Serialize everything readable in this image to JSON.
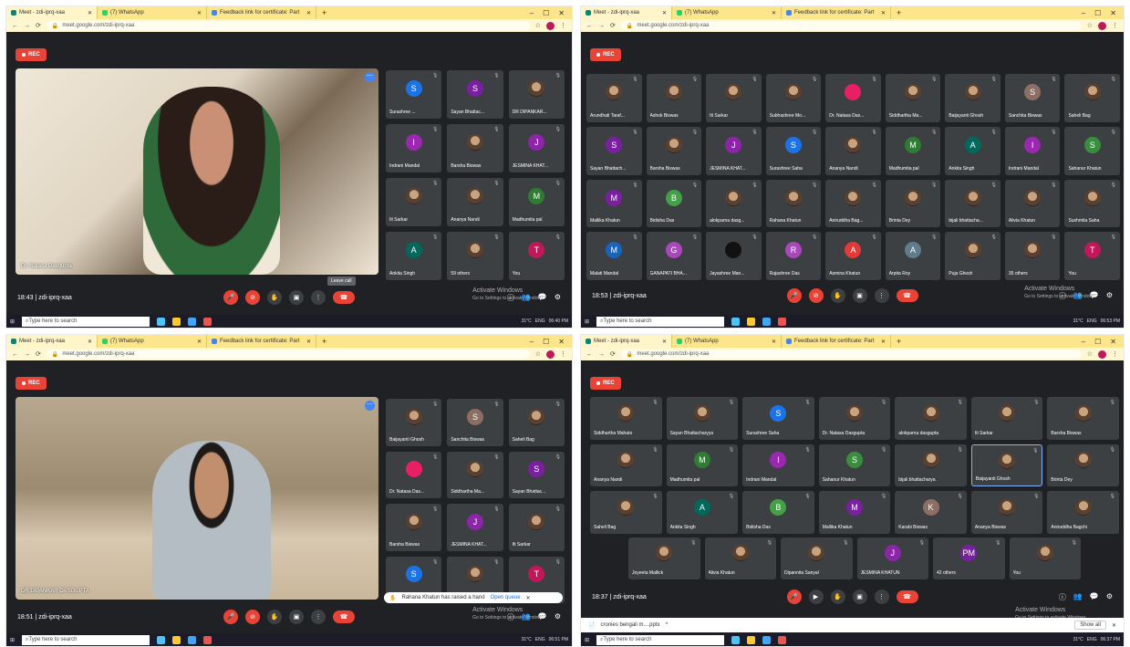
{
  "browser": {
    "tabs": [
      "Meet - zdi-iprq-xaa",
      "(7) WhatsApp",
      "Feedback link for certificate: Part"
    ],
    "new_tab": "+",
    "url": "meet.google.com/zdi-iprq-xaa",
    "controls": [
      "–",
      "☐",
      "✕"
    ]
  },
  "rec_label": "REC",
  "taskbar": {
    "search_placeholder": "Type here to search",
    "weather": "31°C",
    "lang": "ENG"
  },
  "activate": {
    "title": "Activate Windows",
    "sub": "Go to Settings to activate Windows."
  },
  "screens": [
    {
      "time": "18:43",
      "meeting_code": "zdi-iprq-xaa",
      "taskbar_time": "06:40 PM",
      "speaker": "Dr. Natasa Dasgupta",
      "leave_tooltip": "Leave call",
      "tiles": [
        {
          "name": "Surashree ...",
          "initial": "S",
          "color": "#1a73e8"
        },
        {
          "name": "Sayan Bhattac...",
          "initial": "S",
          "color": "#7b1fa2"
        },
        {
          "name": "DR DIPANKAR...",
          "initial": "",
          "color": ""
        },
        {
          "name": "Indrani Mandal",
          "initial": "I",
          "color": "#9c27b0"
        },
        {
          "name": "Barsha Biswas",
          "initial": "",
          "color": ""
        },
        {
          "name": "JESMINA KHAT...",
          "initial": "J",
          "color": "#8e24aa"
        },
        {
          "name": "Iti Sarkar",
          "initial": "",
          "color": ""
        },
        {
          "name": "Ananya Nandi",
          "initial": "",
          "color": ""
        },
        {
          "name": "Madhumita pal",
          "initial": "M",
          "color": "#2e7d32"
        },
        {
          "name": "Ankita Singh",
          "initial": "A",
          "color": "#00695c"
        },
        {
          "name": "59 others",
          "initial": "",
          "color": ""
        },
        {
          "name": "You",
          "initial": "T",
          "color": "#c2185b"
        }
      ]
    },
    {
      "time": "18:53",
      "meeting_code": "zdi-iprq-xaa",
      "taskbar_time": "06:53 PM",
      "tiles": [
        {
          "name": "Arundhati Taraf...",
          "initial": "",
          "color": ""
        },
        {
          "name": "Ashok Biswas",
          "initial": "",
          "color": ""
        },
        {
          "name": "Iti Sarkar",
          "initial": "",
          "color": ""
        },
        {
          "name": "Subhashree Mo...",
          "initial": "",
          "color": ""
        },
        {
          "name": "Dr. Natasa Das...",
          "initial": "",
          "color": "#e91e63"
        },
        {
          "name": "Siddhartha Ma...",
          "initial": "",
          "color": ""
        },
        {
          "name": "Baijayanti Ghosh",
          "initial": "",
          "color": ""
        },
        {
          "name": "Sanchita Biswas",
          "initial": "S",
          "color": "#8d6e63"
        },
        {
          "name": "Saheli Bag",
          "initial": "",
          "color": ""
        },
        {
          "name": "Sayan Bhattach...",
          "initial": "S",
          "color": "#7b1fa2"
        },
        {
          "name": "Barsha Biswas",
          "initial": "",
          "color": ""
        },
        {
          "name": "JESMINA KHAT...",
          "initial": "J",
          "color": "#8e24aa"
        },
        {
          "name": "Surashree Saha",
          "initial": "S",
          "color": "#1a73e8"
        },
        {
          "name": "Ananya Nandi",
          "initial": "",
          "color": ""
        },
        {
          "name": "Madhumita pal",
          "initial": "M",
          "color": "#2e7d32"
        },
        {
          "name": "Ankita Singh",
          "initial": "A",
          "color": "#00695c"
        },
        {
          "name": "Indrani Mandal",
          "initial": "I",
          "color": "#9c27b0"
        },
        {
          "name": "Sahanur Khatun",
          "initial": "S",
          "color": "#388e3c"
        },
        {
          "name": "Mallika Khatun",
          "initial": "M",
          "color": "#7b1fa2"
        },
        {
          "name": "Bidisha Das",
          "initial": "B",
          "color": "#43a047"
        },
        {
          "name": "alokparna dasg...",
          "initial": "",
          "color": ""
        },
        {
          "name": "Rahana Khatun",
          "initial": "",
          "color": ""
        },
        {
          "name": "Aniruddha Bag...",
          "initial": "",
          "color": ""
        },
        {
          "name": "Brinta Dey",
          "initial": "",
          "color": ""
        },
        {
          "name": "bijali bhattacha...",
          "initial": "",
          "color": ""
        },
        {
          "name": "Alivia Khatun",
          "initial": "",
          "color": ""
        },
        {
          "name": "Sushmita Saha",
          "initial": "",
          "color": ""
        },
        {
          "name": "Malati Mandal",
          "initial": "M",
          "color": "#1565c0"
        },
        {
          "name": "GANAPATI BHA...",
          "initial": "G",
          "color": "#ab47bc"
        },
        {
          "name": "Jayashree Man...",
          "initial": "",
          "color": "#111111"
        },
        {
          "name": "Rajashree Das",
          "initial": "R",
          "color": "#ab47bc"
        },
        {
          "name": "Asmina Khatun",
          "initial": "A",
          "color": "#e53935"
        },
        {
          "name": "Arpita Roy",
          "initial": "A",
          "color": "#607d8b"
        },
        {
          "name": "Puja Ghosh",
          "initial": "",
          "color": ""
        },
        {
          "name": "35 others",
          "initial": "",
          "color": ""
        },
        {
          "name": "You",
          "initial": "T",
          "color": "#c2185b"
        }
      ]
    },
    {
      "time": "18:51",
      "meeting_code": "zdi-iprq-xaa",
      "taskbar_time": "06:51 PM",
      "speaker": "DR DIPANKAR DASGUPTA",
      "toast": {
        "text": "Rahana Khatun has raised a hand",
        "action": "Open queue",
        "close": "✕"
      },
      "tiles": [
        {
          "name": "Baijayanti Ghosh",
          "initial": "",
          "color": ""
        },
        {
          "name": "Sanchita Biswas",
          "initial": "S",
          "color": "#8d6e63"
        },
        {
          "name": "Saheli Bag",
          "initial": "",
          "color": ""
        },
        {
          "name": "Dr. Natasa Das...",
          "initial": "",
          "color": "#e91e63"
        },
        {
          "name": "Siddhartha Ma...",
          "initial": "",
          "color": ""
        },
        {
          "name": "Sayan Bhattac...",
          "initial": "S",
          "color": "#7b1fa2"
        },
        {
          "name": "Barsha Biswas",
          "initial": "",
          "color": ""
        },
        {
          "name": "JESMINA KHAT...",
          "initial": "J",
          "color": "#8e24aa"
        },
        {
          "name": "Iti Sarkar",
          "initial": "",
          "color": ""
        },
        {
          "name": "Surashree Saha",
          "initial": "S",
          "color": "#1a73e8"
        },
        {
          "name": "61 others",
          "initial": "",
          "color": ""
        },
        {
          "name": "You",
          "initial": "T",
          "color": "#c2185b"
        }
      ]
    },
    {
      "time": "18:37",
      "meeting_code": "zdi-iprq-xaa",
      "taskbar_time": "06:37 PM",
      "download": {
        "file": "cronies bengali m....pptx",
        "show_all": "Show all"
      },
      "tiles": [
        {
          "name": "Siddhartha Mahato",
          "initial": "",
          "color": ""
        },
        {
          "name": "Sayan Bhattacharyya",
          "initial": "",
          "color": ""
        },
        {
          "name": "Surashree Saha",
          "initial": "S",
          "color": "#1a73e8"
        },
        {
          "name": "Dr. Natasa Dasgupta",
          "initial": "",
          "color": ""
        },
        {
          "name": "alokparna dasgupta",
          "initial": "",
          "color": ""
        },
        {
          "name": "Iti Sarkar",
          "initial": "",
          "color": ""
        },
        {
          "name": "Barsha Biswas",
          "initial": "",
          "color": ""
        },
        {
          "name": "Ananya Nandi",
          "initial": "",
          "color": ""
        },
        {
          "name": "Madhumita pal",
          "initial": "M",
          "color": "#2e7d32"
        },
        {
          "name": "Indrani Mandal",
          "initial": "I",
          "color": "#9c27b0"
        },
        {
          "name": "Sahanur Khatun",
          "initial": "S",
          "color": "#388e3c"
        },
        {
          "name": "bijali bhattacharya",
          "initial": "",
          "color": ""
        },
        {
          "name": "Baijayanti Ghosh",
          "initial": "",
          "color": ""
        },
        {
          "name": "Brinta Dey",
          "initial": "",
          "color": ""
        },
        {
          "name": "Saheli Bag",
          "initial": "",
          "color": ""
        },
        {
          "name": "Ankita Singh",
          "initial": "A",
          "color": "#00695c"
        },
        {
          "name": "Bidisha Das",
          "initial": "B",
          "color": "#43a047"
        },
        {
          "name": "Mallika Khatun",
          "initial": "M",
          "color": "#7b1fa2"
        },
        {
          "name": "Karabi Biswas",
          "initial": "K",
          "color": "#8d6e63"
        },
        {
          "name": "Ananya Biswas",
          "initial": "",
          "color": ""
        },
        {
          "name": "Aniruddha Bagchi",
          "initial": "",
          "color": ""
        },
        {
          "name": "Joyeeta Mallick",
          "initial": "",
          "color": ""
        },
        {
          "name": "Alivia Khatun",
          "initial": "",
          "color": ""
        },
        {
          "name": "Dipannita Sanyal",
          "initial": "",
          "color": ""
        },
        {
          "name": "JESMINA KHATUN",
          "initial": "J",
          "color": "#8e24aa"
        },
        {
          "name": "42 others",
          "initial": "PM",
          "color": "#7b1fa2"
        },
        {
          "name": "You",
          "initial": "",
          "color": ""
        }
      ]
    }
  ]
}
